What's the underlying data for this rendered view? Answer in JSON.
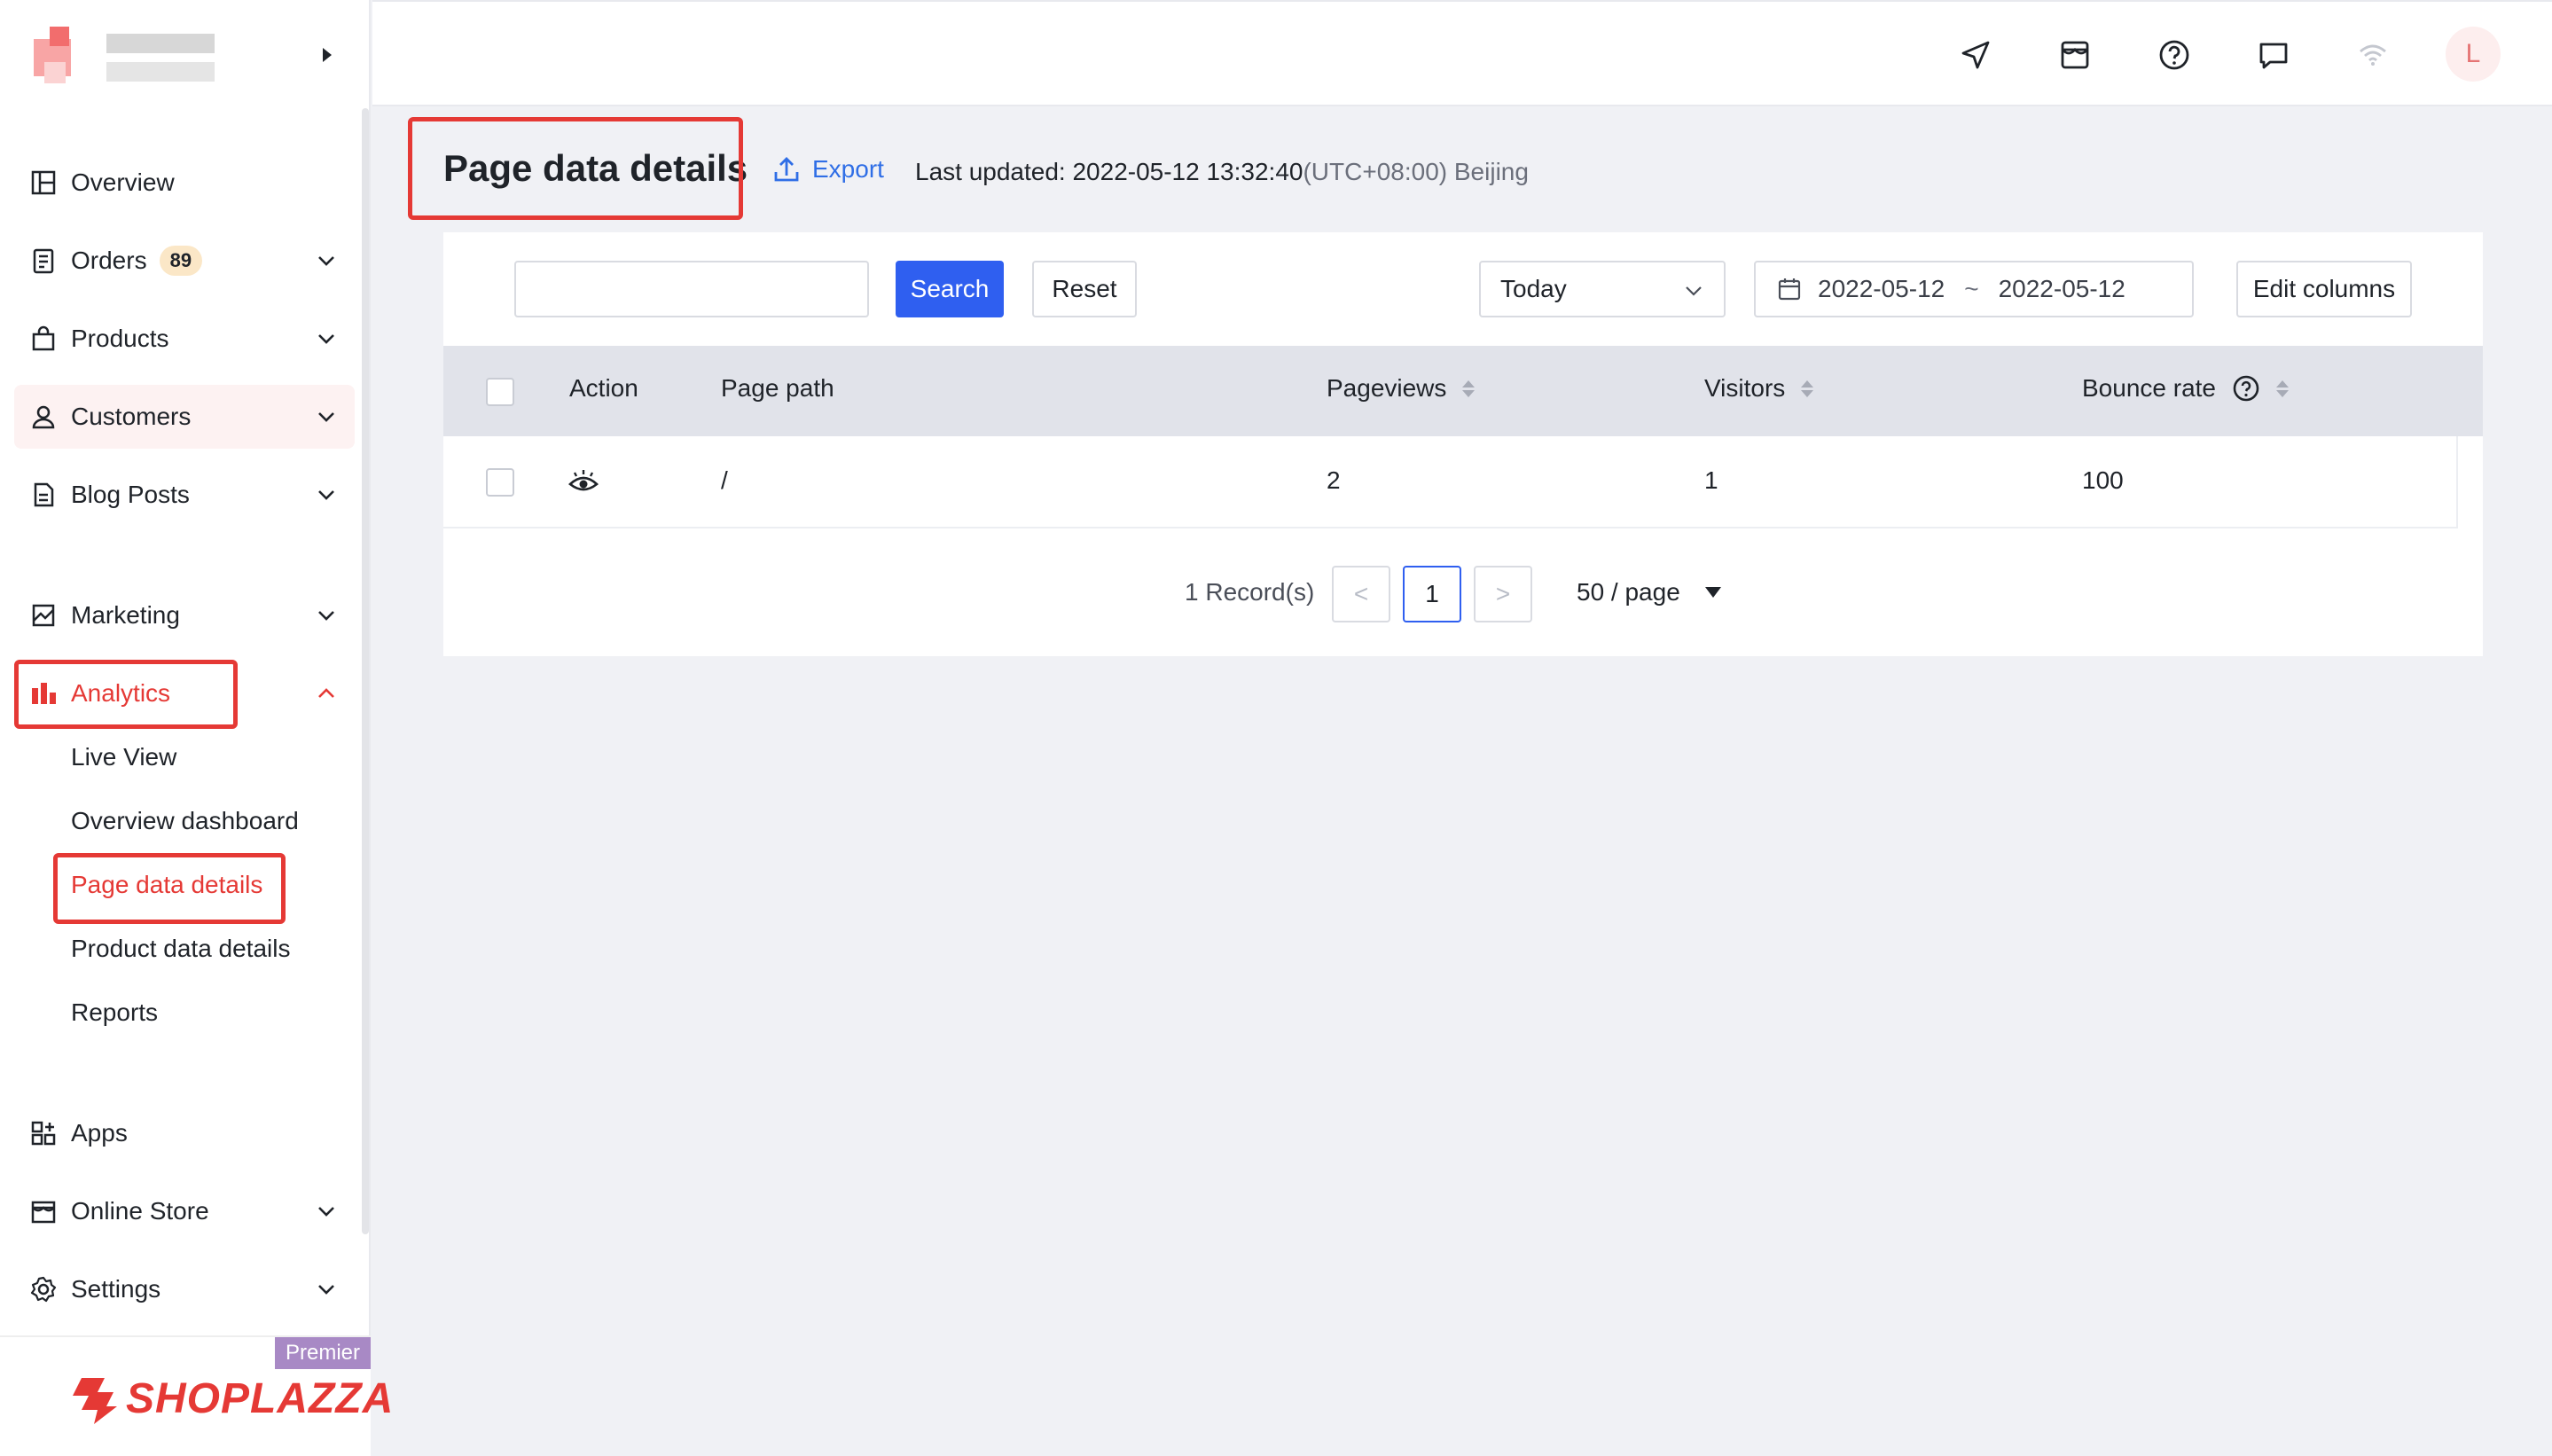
{
  "header": {
    "title": "Page data details",
    "export_label": "Export",
    "last_updated_label": "Last updated: 2022-05-12 13:32:40",
    "timezone": "(UTC+08:00) Beijing",
    "avatar_letter": "L"
  },
  "sidebar": {
    "items": [
      {
        "label": "Overview",
        "icon": "overview-icon"
      },
      {
        "label": "Orders",
        "icon": "orders-icon",
        "badge": "89"
      },
      {
        "label": "Products",
        "icon": "products-icon"
      },
      {
        "label": "Customers",
        "icon": "customers-icon"
      },
      {
        "label": "Blog Posts",
        "icon": "blog-icon"
      },
      {
        "label": "Marketing",
        "icon": "marketing-icon"
      },
      {
        "label": "Analytics",
        "icon": "analytics-icon"
      },
      {
        "label": "Apps",
        "icon": "apps-icon"
      },
      {
        "label": "Online Store",
        "icon": "store-icon"
      },
      {
        "label": "Settings",
        "icon": "settings-icon"
      }
    ],
    "analytics_sub": [
      "Live View",
      "Overview dashboard",
      "Page data details",
      "Product data details",
      "Reports"
    ],
    "footer": {
      "badge": "Premier",
      "logo_text": "SHOPLAZZA"
    }
  },
  "toolbar": {
    "search_value": "",
    "search_label": "Search",
    "reset_label": "Reset",
    "range_select": "Today",
    "date_start": "2022-05-12",
    "date_sep": "~",
    "date_end": "2022-05-12",
    "edit_columns_label": "Edit columns"
  },
  "table": {
    "columns": [
      "Action",
      "Page path",
      "Pageviews",
      "Visitors",
      "Bounce rate"
    ],
    "rows": [
      {
        "page_path": "/",
        "pageviews": "2",
        "visitors": "1",
        "bounce_rate": "100"
      }
    ]
  },
  "pagination": {
    "records": "1 Record(s)",
    "prev": "<",
    "current": "1",
    "next": ">",
    "page_size": "50 / page"
  },
  "colors": {
    "accent_red": "#e53935",
    "primary_blue": "#2f5ff0",
    "link_blue": "#2f6ee6"
  }
}
